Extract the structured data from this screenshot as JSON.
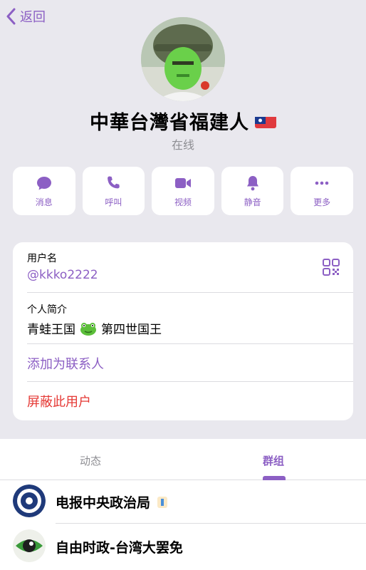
{
  "nav": {
    "back_label": "返回"
  },
  "profile": {
    "name": "中華台灣省福建人",
    "status": "在线"
  },
  "actions": [
    {
      "label": "消息",
      "icon": "message-icon"
    },
    {
      "label": "呼叫",
      "icon": "phone-icon"
    },
    {
      "label": "视频",
      "icon": "video-icon"
    },
    {
      "label": "静音",
      "icon": "bell-icon"
    },
    {
      "label": "更多",
      "icon": "more-icon"
    }
  ],
  "info": {
    "username_label": "用户名",
    "username": "@kkko2222",
    "bio_label": "个人简介",
    "bio_prefix": "青蛙王国",
    "bio_suffix": "第四世国王",
    "add_contact": "添加为联系人",
    "block_user": "屏蔽此用户"
  },
  "tabs": [
    {
      "label": "动态",
      "active": false
    },
    {
      "label": "群组",
      "active": true
    }
  ],
  "groups": [
    {
      "name": "电报中央政治局",
      "icon": "emblem-icon"
    },
    {
      "name": "自由时政-台湾大罢免",
      "icon": "eye-icon"
    }
  ],
  "colors": {
    "accent": "#8c5fc4",
    "danger": "#e53935",
    "background": "#efeff4"
  }
}
